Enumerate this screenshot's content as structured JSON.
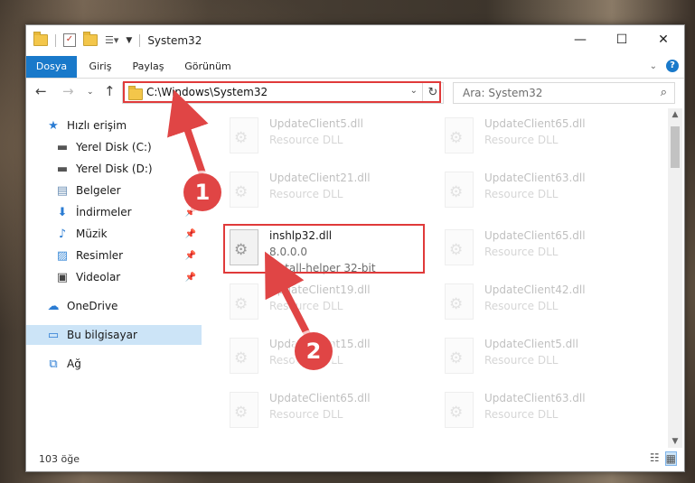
{
  "window": {
    "title": "System32",
    "controls": {
      "minimize": "—",
      "maximize": "☐",
      "close": "✕"
    }
  },
  "ribbon": {
    "tabs": [
      "Dosya",
      "Giriş",
      "Paylaş",
      "Görünüm"
    ],
    "active_tab": "Dosya",
    "help": "?"
  },
  "address_bar": {
    "path": "C:\\Windows\\System32",
    "search_placeholder": "Ara: System32"
  },
  "nav_pane": {
    "items": [
      {
        "label": "Hızlı erişim",
        "icon": "star-icon",
        "pinned": false
      },
      {
        "label": "Yerel Disk (C:)",
        "icon": "drive-icon",
        "pinned": false
      },
      {
        "label": "Yerel Disk (D:)",
        "icon": "drive-icon",
        "pinned": false
      },
      {
        "label": "Belgeler",
        "icon": "document-icon",
        "pinned": false
      },
      {
        "label": "İndirmeler",
        "icon": "download-icon",
        "pinned": true
      },
      {
        "label": "Müzik",
        "icon": "music-icon",
        "pinned": true
      },
      {
        "label": "Resimler",
        "icon": "pictures-icon",
        "pinned": true
      },
      {
        "label": "Videolar",
        "icon": "video-icon",
        "pinned": true
      },
      {
        "label": "OneDrive",
        "icon": "cloud-icon",
        "pinned": false
      },
      {
        "label": "Bu bilgisayar",
        "icon": "computer-icon",
        "pinned": false,
        "selected": true
      },
      {
        "label": "Ağ",
        "icon": "network-icon",
        "pinned": false
      }
    ]
  },
  "files": {
    "left_column": [
      {
        "name": "UpdateClient5.dll",
        "desc": "Resource DLL",
        "faded": true
      },
      {
        "name": "UpdateClient21.dll",
        "desc": "Resource DLL",
        "faded": true
      },
      {
        "name": "inshlp32.dll",
        "version": "8.0.0.0",
        "desc": "install-helper 32-bit",
        "faded": false,
        "highlighted": true
      },
      {
        "name": "UpdateClient19.dll",
        "desc": "Resource DLL",
        "faded": true
      },
      {
        "name": "UpdateClient15.dll",
        "desc": "Resource DLL",
        "faded": true
      },
      {
        "name": "UpdateClient65.dll",
        "desc": "Resource DLL",
        "faded": true
      }
    ],
    "right_column": [
      {
        "name": "UpdateClient65.dll",
        "desc": "Resource DLL",
        "faded": true
      },
      {
        "name": "UpdateClient63.dll",
        "desc": "Resource DLL",
        "faded": true
      },
      {
        "name": "UpdateClient65.dll",
        "desc": "Resource DLL",
        "faded": true
      },
      {
        "name": "UpdateClient42.dll",
        "desc": "Resource DLL",
        "faded": true
      },
      {
        "name": "UpdateClient5.dll",
        "desc": "Resource DLL",
        "faded": true
      },
      {
        "name": "UpdateClient63.dll",
        "desc": "Resource DLL",
        "faded": true
      }
    ]
  },
  "status_bar": {
    "item_count": "103 öğe"
  },
  "annotations": {
    "step1": "1",
    "step2": "2",
    "accent_color": "#e04545"
  }
}
